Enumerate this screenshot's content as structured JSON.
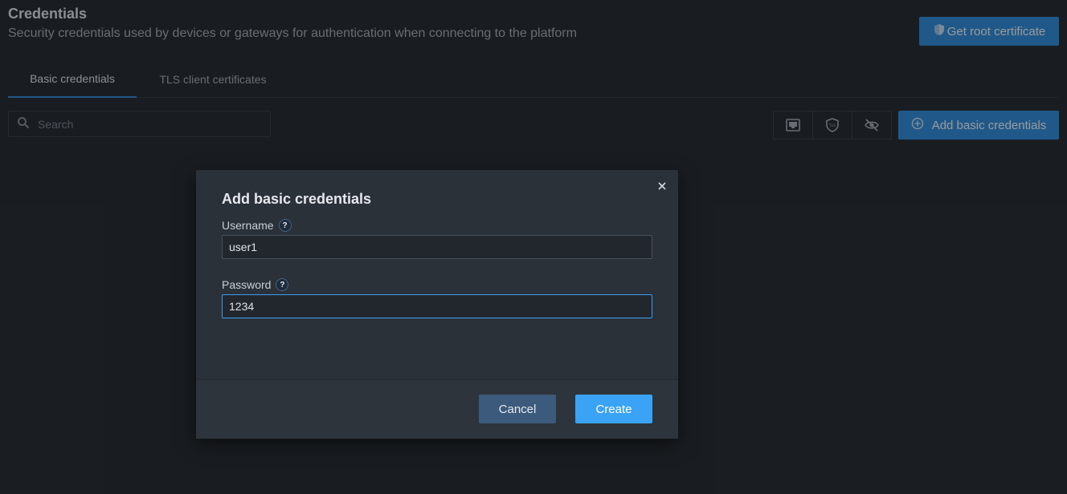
{
  "header": {
    "title": "Credentials",
    "subtitle": "Security credentials used by devices or gateways for authentication when connecting to the platform",
    "root_cert_button": "Get root certificate"
  },
  "tabs": [
    {
      "label": "Basic credentials",
      "active": true
    },
    {
      "label": "TLS client certificates",
      "active": false
    }
  ],
  "toolbar": {
    "search_placeholder": "Search",
    "icon_buttons": [
      "ethernet-port-icon",
      "tls-shield-icon",
      "eye-off-icon"
    ],
    "add_button": "Add basic credentials"
  },
  "modal": {
    "title": "Add basic credentials",
    "username_label": "Username",
    "username_value": "user1",
    "password_label": "Password",
    "password_value": "1234",
    "help_glyph": "?",
    "cancel_label": "Cancel",
    "create_label": "Create"
  },
  "colors": {
    "accent": "#2f8fe0",
    "create_button": "#3aa3f5",
    "cancel_button": "#3b5a7c",
    "modal_background": "#2b3138",
    "page_background": "#24282e"
  }
}
